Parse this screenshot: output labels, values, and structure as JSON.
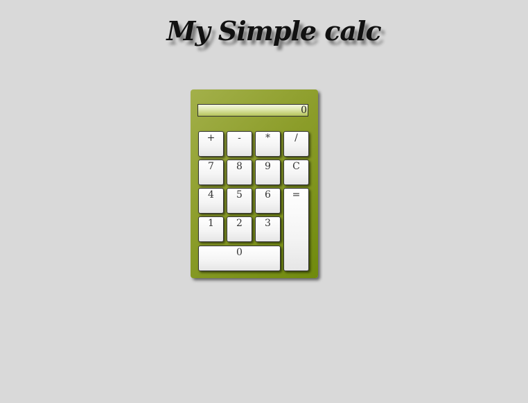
{
  "title": "My Simple calc",
  "display": {
    "value": "0"
  },
  "keys": {
    "plus": "+",
    "minus": "-",
    "multiply": "*",
    "divide": "/",
    "seven": "7",
    "eight": "8",
    "nine": "9",
    "clear": "C",
    "four": "4",
    "five": "5",
    "six": "6",
    "one": "1",
    "two": "2",
    "three": "3",
    "zero": "0",
    "equals": "="
  },
  "colors": {
    "background": "#d9d9d9",
    "calc_body": "#8c9d2a",
    "display": "#e0e8b0"
  }
}
